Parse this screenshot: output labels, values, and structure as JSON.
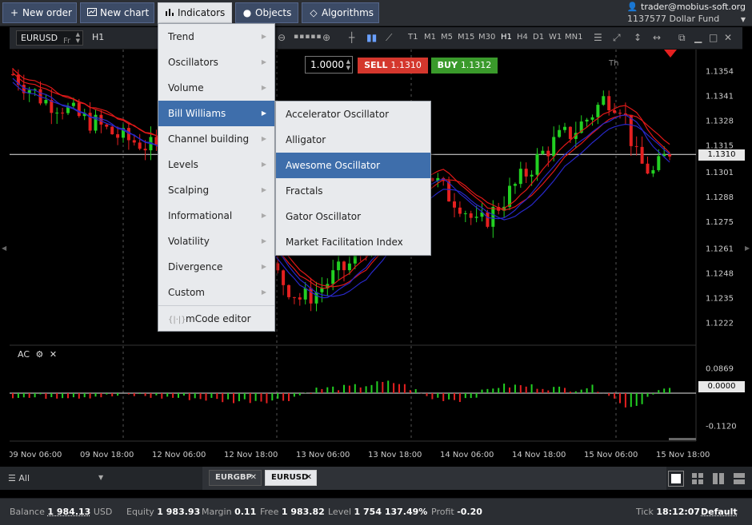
{
  "toolbar": {
    "new_order": "New order",
    "new_chart": "New chart",
    "indicators": "Indicators",
    "objects": "Objects",
    "algorithms": "Algorithms"
  },
  "account": {
    "user": "trader@mobius-soft.org",
    "number": "1137577",
    "fund": "Dollar Fund"
  },
  "chart_toolbar": {
    "symbol": "EURUSD",
    "timeframe": "H1",
    "timeframes": [
      "T1",
      "M1",
      "M5",
      "M15",
      "M30",
      "H1",
      "H4",
      "D1",
      "W1",
      "MN1"
    ],
    "selected_timeframe": "H1"
  },
  "trade": {
    "quantity": "1.0000",
    "sell_label": "SELL",
    "sell_price": "1.1310",
    "buy_label": "BUY",
    "buy_price": "1.1312"
  },
  "indicators_menu": {
    "items": [
      {
        "label": "Trend"
      },
      {
        "label": "Oscillators"
      },
      {
        "label": "Volume"
      },
      {
        "label": "Bill Williams"
      },
      {
        "label": "Channel building"
      },
      {
        "label": "Levels"
      },
      {
        "label": "Scalping"
      },
      {
        "label": "Informational"
      },
      {
        "label": "Volatility"
      },
      {
        "label": "Divergence"
      },
      {
        "label": "Custom"
      }
    ],
    "editor": "mCode editor",
    "selected_index": 3
  },
  "bill_williams_menu": {
    "items": [
      {
        "label": "Accelerator Oscillator"
      },
      {
        "label": "Alligator"
      },
      {
        "label": "Awesome Oscillator"
      },
      {
        "label": "Fractals"
      },
      {
        "label": "Gator Oscillator"
      },
      {
        "label": "Market Facilitation Index"
      }
    ],
    "selected_index": 2
  },
  "chart_data": {
    "type": "candlestick",
    "symbol": "EURUSD",
    "timeframe": "H1",
    "price_axis": {
      "ticks": [
        "1.1354",
        "1.1341",
        "1.1328",
        "1.1315",
        "1.1301",
        "1.1288",
        "1.1275",
        "1.1261",
        "1.1248",
        "1.1235",
        "1.1222"
      ],
      "ylim": [
        1.121,
        1.1365
      ],
      "current_price": "1.1310"
    },
    "day_labels": [
      "Fr",
      "Th"
    ],
    "x_ticks": [
      "09 Nov 06:00",
      "09 Nov 18:00",
      "12 Nov 06:00",
      "12 Nov 18:00",
      "13 Nov 06:00",
      "13 Nov 18:00",
      "14 Nov 06:00",
      "14 Nov 18:00",
      "15 Nov 06:00",
      "15 Nov 18:00"
    ],
    "close_path": [
      1.1352,
      1.1345,
      1.1338,
      1.1336,
      1.133,
      1.1327,
      1.1322,
      1.1318,
      1.1316,
      1.1312,
      1.1305,
      1.13,
      1.1292,
      1.1284,
      1.1272,
      1.1262,
      1.1252,
      1.1242,
      1.1234,
      1.1238,
      1.1246,
      1.1252,
      1.1262,
      1.1274,
      1.129,
      1.1304,
      1.13,
      1.129,
      1.1284,
      1.1272,
      1.128,
      1.129,
      1.13,
      1.131,
      1.1318,
      1.1322,
      1.133,
      1.134,
      1.1336,
      1.1306,
      1.13,
      1.1312
    ],
    "indicator": {
      "name": "AC",
      "ticks": [
        "0.0869",
        "0.0000",
        "-0.1120"
      ],
      "ylim": [
        -0.16,
        0.16
      ]
    }
  },
  "bottom": {
    "filter": "All",
    "tabs": [
      {
        "label": "EURGBP"
      },
      {
        "label": "EURUSD"
      }
    ],
    "active_tab": 1
  },
  "status": {
    "balance_label": "Balance",
    "balance_value": "1 984.13",
    "balance_ccy": "USD",
    "equity_label": "Equity",
    "equity_value": "1 983.93",
    "margin_label": "Margin",
    "margin_value": "0.11",
    "free_label": "Free",
    "free_value": "1 983.82",
    "level_label": "Level",
    "level_value": "1 754 137.49%",
    "profit_label": "Profit",
    "profit_value": "-0.20",
    "tick_label": "Tick",
    "tick_value": "18:12:07",
    "tick_mode": "Default"
  },
  "colors": {
    "bull": "#22d022",
    "bear": "#e52020",
    "alligator_red": "#e01818",
    "alligator_blue": "#2828c8",
    "menu_highlight": "#3e6eab"
  }
}
